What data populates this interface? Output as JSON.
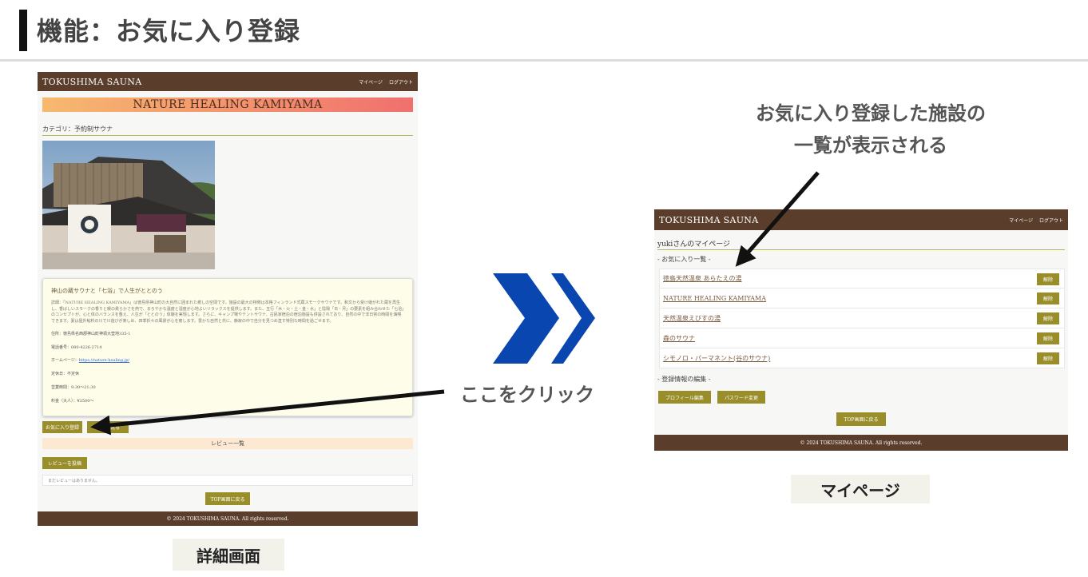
{
  "slide": {
    "title": "機能：お気に入り登録"
  },
  "detail_screen": {
    "brand": "TOKUSHIMA SAUNA",
    "nav": [
      "マイページ",
      "ログアウト"
    ],
    "facility_name": "NATURE HEALING KAMIYAMA",
    "category": "カテゴリ：予約制サウナ",
    "info": {
      "lead": "神山の蔵サウナと「七浴」で人生がととのう",
      "description": "詳細：「NATURE HEALING KAMIYAMA」は徳島県神山町の大自然に囲まれた癒しの空間です。施設の最大の特徴は本格フィンランド式蔵スモークサウナです。和文から受け継がれた蔵を再生し、香ばしいスモークの香りと暖の柔らかさを熱で、まろやかな温度と湿度が心地よいリラックスを提供します。また、五行「木・火・土・金・水」と陰陽「日・月」の要素を組み合わせた「七浴」のコンセプトが、心と体のバランスを整え、人生が「ととのう」体験を実現します。さらに、キャンプ場やテントサウナ、古民家宿泊の宿泊施設も併設されており、自然の中で非日常の時間を満喫できます。夏は屋外鮎料の川で川遊びが楽しめ、四季折々の風景が心を癒します。豊かな自然と共に、静寂の中で自分を見つめ直す特別な時間を過ごせます。",
      "address": "住所：徳島県名西郡神山町神領大埜地335-1",
      "phone": "電話番号：080-4226-2714",
      "homepage_label": "ホームページ：",
      "homepage_link": "https://nature-healing.jp/",
      "closed": "定休日：不定休",
      "hours": "営業時間：9:30～21:30",
      "price": "料金（大人）：¥3500～"
    },
    "favorite_button": "お気に入り登録",
    "map_button": "地図を見る",
    "review_heading": "レビュー一覧",
    "review_button": "レビューを投稿",
    "no_reviews": "まだレビューはありません。",
    "top_button": "TOP画面に戻る",
    "footer": "© 2024 TOKUSHIMA SAUNA. All rights reserved."
  },
  "mypage_screen": {
    "brand": "TOKUSHIMA SAUNA",
    "nav": [
      "マイページ",
      "ログアウト"
    ],
    "title": "yukiさんのマイページ",
    "favorites_heading": "- お気に入り一覧 -",
    "favorites": [
      {
        "name": "徳島天然温泉 あらたえの湯",
        "action": "解除"
      },
      {
        "name": "NATURE HEALING KAMIYAMA",
        "action": "解除"
      },
      {
        "name": "天然温泉えびすの湯",
        "action": "解除"
      },
      {
        "name": "森のサウナ",
        "action": "解除"
      },
      {
        "name": "シモノロ・パーマネント(谷のサウナ)",
        "action": "解除"
      }
    ],
    "edit_heading": "- 登録情報の編集 -",
    "edit_buttons": [
      "プロフィール編集",
      "パスワード変更"
    ],
    "top_button": "TOP画面に戻る",
    "footer": "© 2024 TOKUSHIMA SAUNA. All rights reserved."
  },
  "annotations": {
    "favorites_note_line1": "お気に入り登録した施設の",
    "favorites_note_line2": "一覧が表示される",
    "click_here": "ここをクリック",
    "caption_detail": "詳細画面",
    "caption_mypage": "マイページ"
  },
  "colors": {
    "navbar": "#5b3d2b",
    "button_olive": "#9a8e2a",
    "chevron_blue": "#0a46b0"
  }
}
